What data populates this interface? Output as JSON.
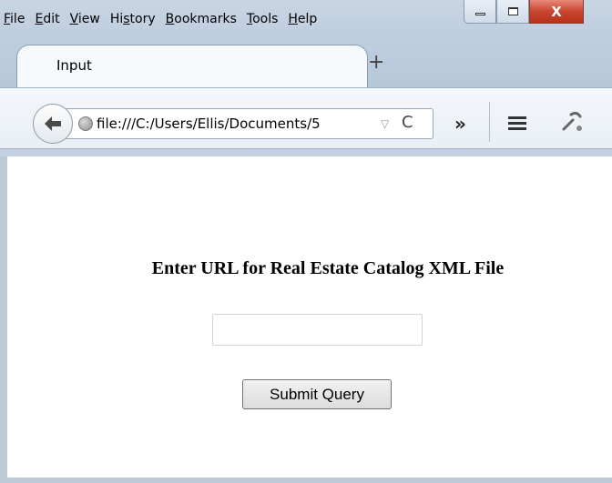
{
  "menubar": {
    "items": [
      {
        "accel": "F",
        "rest": "ile"
      },
      {
        "accel": "E",
        "rest": "dit"
      },
      {
        "accel": "V",
        "rest": "iew"
      },
      {
        "pre": "Hi",
        "accel": "s",
        "rest": "tory"
      },
      {
        "accel": "B",
        "rest": "ookmarks"
      },
      {
        "accel": "T",
        "rest": "ools"
      },
      {
        "accel": "H",
        "rest": "elp"
      }
    ]
  },
  "window": {
    "close_glyph": "X"
  },
  "tabs": {
    "active_title": "Input",
    "new_tab_glyph": "+"
  },
  "toolbar": {
    "back_icon": "back-arrow-icon",
    "url": "file:///C:/Users/Ellis/Documents/5",
    "dropmarker": "▽",
    "reload_glyph": "C",
    "overflow_glyph": "»",
    "dev_icon": "developer-wrench-icon"
  },
  "page": {
    "heading": "Enter URL for Real Estate Catalog XML File",
    "input_value": "",
    "submit_label": "Submit Query"
  },
  "colors": {
    "chrome": "#bfcedf",
    "close": "#c7452f"
  }
}
